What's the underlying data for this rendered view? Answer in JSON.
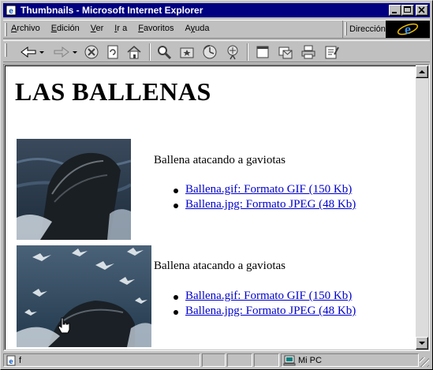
{
  "window": {
    "title": "Thumbnails - Microsoft Internet Explorer",
    "minimize_label": "_",
    "maximize_label": "□",
    "close_label": "×"
  },
  "menu": {
    "items": [
      {
        "label": "Archivo",
        "accel": "A"
      },
      {
        "label": "Edición",
        "accel": "E"
      },
      {
        "label": "Ver",
        "accel": "V"
      },
      {
        "label": "Ir a",
        "accel": "I"
      },
      {
        "label": "Favoritos",
        "accel": "F"
      },
      {
        "label": "Ayuda",
        "accel": "y"
      }
    ],
    "address_label": "Dirección"
  },
  "toolbar": {
    "icons": [
      "back-icon",
      "forward-icon",
      "stop-icon",
      "refresh-icon",
      "home-icon",
      "search-icon",
      "favorites-icon",
      "history-icon",
      "channels-icon",
      "fullscreen-icon",
      "mail-icon",
      "print-icon",
      "edit-icon"
    ]
  },
  "page": {
    "title": "LAS BALLENAS",
    "entries": [
      {
        "image": "whale-thumbnail-1",
        "caption": "Ballena atacando a gaviotas",
        "links": [
          "Ballena.gif: Formato GIF (150 Kb)",
          "Ballena.jpg: Formato JPEG (48 Kb)"
        ]
      },
      {
        "image": "whale-thumbnail-2",
        "caption": "Ballena atacando a gaviotas",
        "links": [
          "Ballena.gif: Formato GIF (150 Kb)",
          "Ballena.jpg: Formato JPEG (48 Kb)"
        ]
      }
    ]
  },
  "status": {
    "left_text": "f",
    "zone": "Mi PC"
  },
  "colors": {
    "titlebar": "#000080",
    "link": "#0000cc",
    "chrome": "#c0c0c0"
  }
}
